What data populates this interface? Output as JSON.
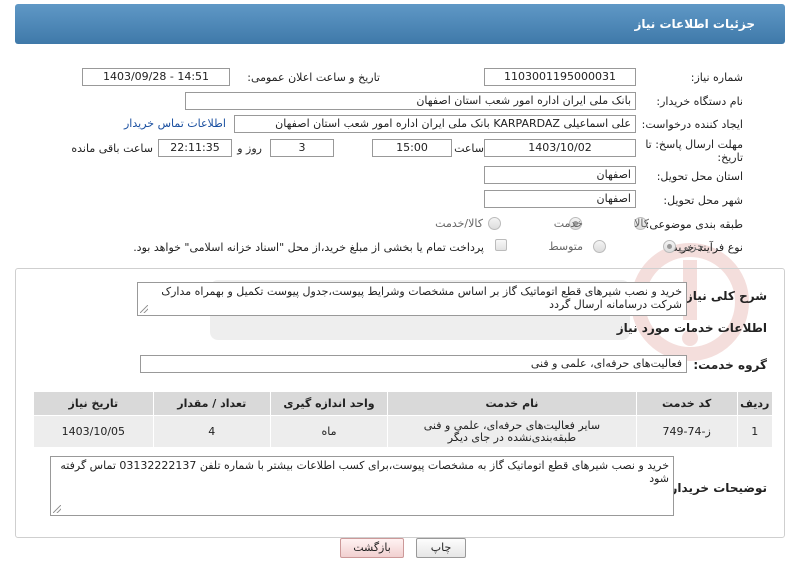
{
  "header": {
    "title": "جزئیات اطلاعات نیاز"
  },
  "fields": {
    "need_number_label": "شماره نیاز:",
    "need_number": "1103001195000031",
    "announce_label": "تاریخ و ساعت اعلان عمومی:",
    "announce_value": "1403/09/28 - 14:51",
    "buyer_org_label": "نام دستگاه خریدار:",
    "buyer_org": "بانک ملی ایران اداره امور شعب استان اصفهان",
    "requester_label": "ایجاد کننده درخواست:",
    "requester": "علی اسماعیلی KARPARDAZ بانک ملی ایران اداره امور شعب استان اصفهان",
    "contact_link": "اطلاعات تماس خریدار",
    "deadline_label": "مهلت ارسال پاسخ: تا تاریخ:",
    "deadline_date": "1403/10/02",
    "time_label": "ساعت",
    "deadline_time": "15:00",
    "days_value": "3",
    "days_label": "روز و",
    "remaining_time": "22:11:35",
    "remaining_label": "ساعت باقی مانده",
    "province_label": "استان محل تحویل:",
    "province": "اصفهان",
    "city_label": "شهر محل تحویل:",
    "city": "اصفهان",
    "category_label": "طبقه بندی موضوعی:",
    "category_options": [
      "کالا",
      "خدمت",
      "کالا/خدمت"
    ],
    "category_selected": "خدمت",
    "process_label": "نوع فرآیند خرید :",
    "process_options": [
      "جزیی",
      "متوسط"
    ],
    "process_selected": "جزیی",
    "payment_note": "پرداخت تمام یا بخشی از مبلغ خرید،از محل \"اسناد خزانه اسلامی\" خواهد بود."
  },
  "summary": {
    "label": "شرح کلی نیاز:",
    "text": "خرید و نصب شیرهای قطع اتوماتیک گاز بر اساس مشخصات وشرایط پیوست،جدول پیوست تکمیل و بهمراه مدارک شرکت درسامانه ارسال گردد"
  },
  "services": {
    "section_title": "اطلاعات خدمات مورد نیاز",
    "group_label": "گروه خدمت:",
    "group_value": "فعالیت‌های حرفه‌ای، علمی و فنی",
    "columns": [
      "ردیف",
      "کد خدمت",
      "نام خدمت",
      "واحد اندازه گیری",
      "تعداد / مقدار",
      "تاریخ نیاز"
    ],
    "rows": [
      [
        "1",
        "ز-74-749",
        "سایر فعالیت‌های حرفه‌ای، علمی و فنی طبقه‌بندی‌نشده در جای دیگر",
        "ماه",
        "4",
        "1403/10/05"
      ]
    ]
  },
  "buyer_notes": {
    "label": "توضیحات خریدار:",
    "text": "خرید و نصب شیرهای قطع اتوماتیک گاز به مشخصات پیوست،برای کسب اطلاعات بیشتر با شماره تلفن 03132222137 تماس گرفته شود"
  },
  "buttons": {
    "print": "چاپ",
    "back": "بازگشت"
  },
  "colors": {
    "header": "#4a86b8",
    "accent_link": "#1a4fa0"
  }
}
